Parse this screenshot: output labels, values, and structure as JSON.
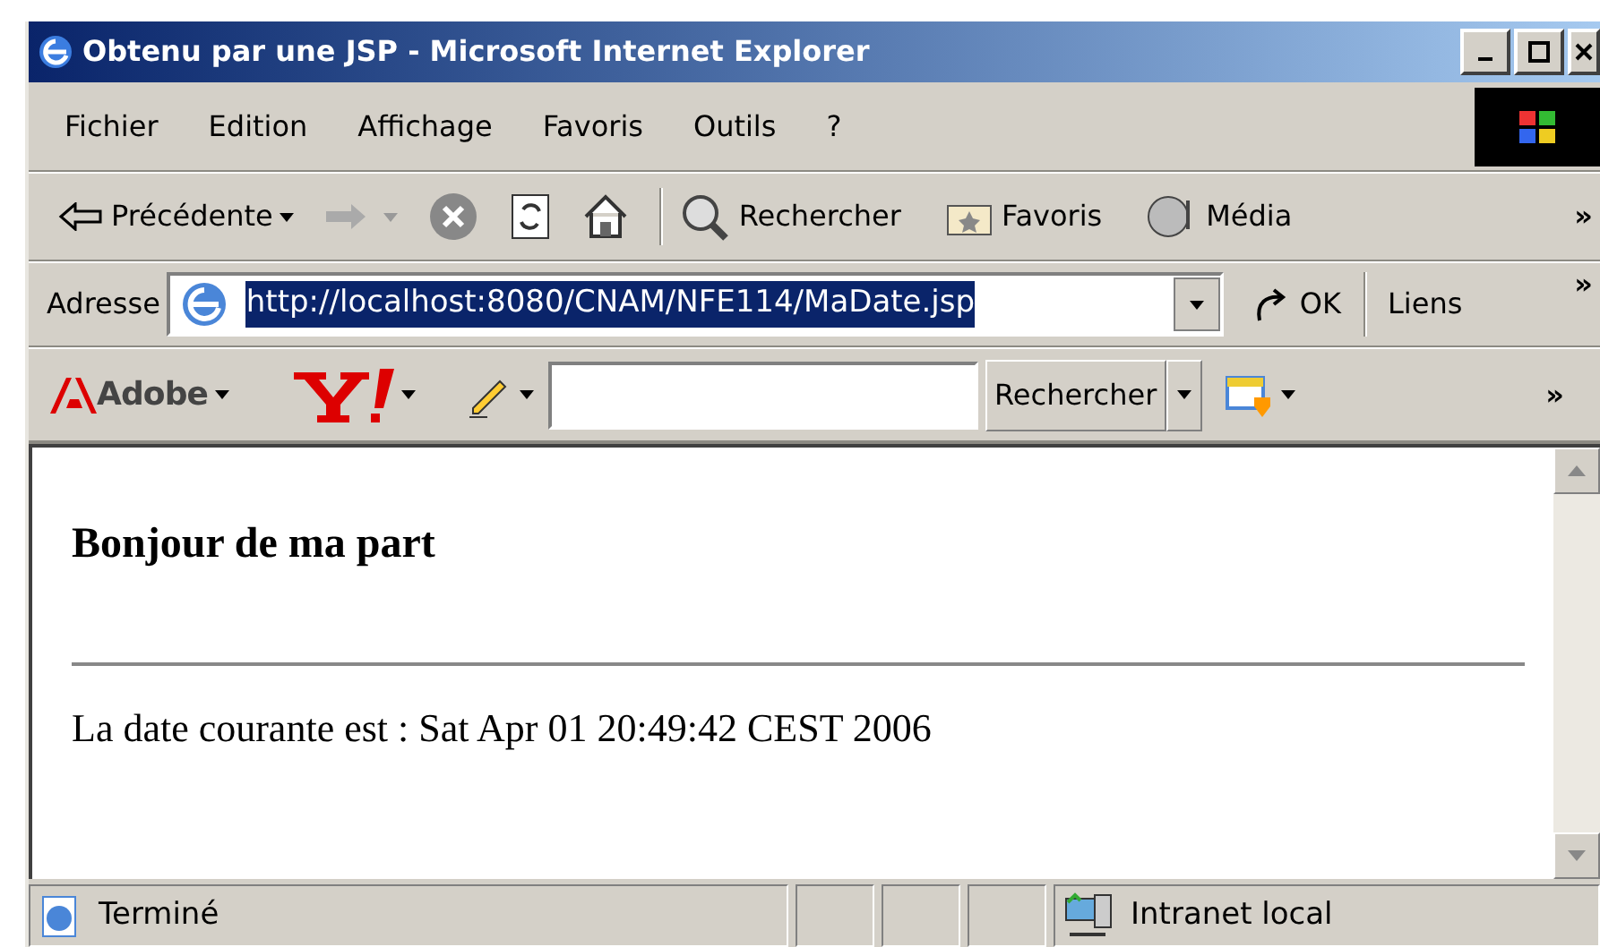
{
  "window": {
    "title": "Obtenu par une JSP - Microsoft Internet Explorer"
  },
  "menu": [
    "Fichier",
    "Edition",
    "Affichage",
    "Favoris",
    "Outils",
    "?"
  ],
  "toolbar": {
    "back": "Précédente",
    "search": "Rechercher",
    "favorites": "Favoris",
    "media": "Média",
    "more": "»"
  },
  "address": {
    "label": "Adresse",
    "value": "http://localhost:8080/CNAM/NFE114/MaDate.jsp",
    "go": "OK",
    "links": "Liens",
    "links_more": "»"
  },
  "addon_bar": {
    "adobe": "Adobe",
    "search_button": "Rechercher",
    "more": "»"
  },
  "page": {
    "heading": "Bonjour de ma part",
    "text": "La date courante est : Sat Apr 01 20:49:42 CEST 2006"
  },
  "status_bar": {
    "text": "Terminé",
    "zone": "Intranet local"
  }
}
